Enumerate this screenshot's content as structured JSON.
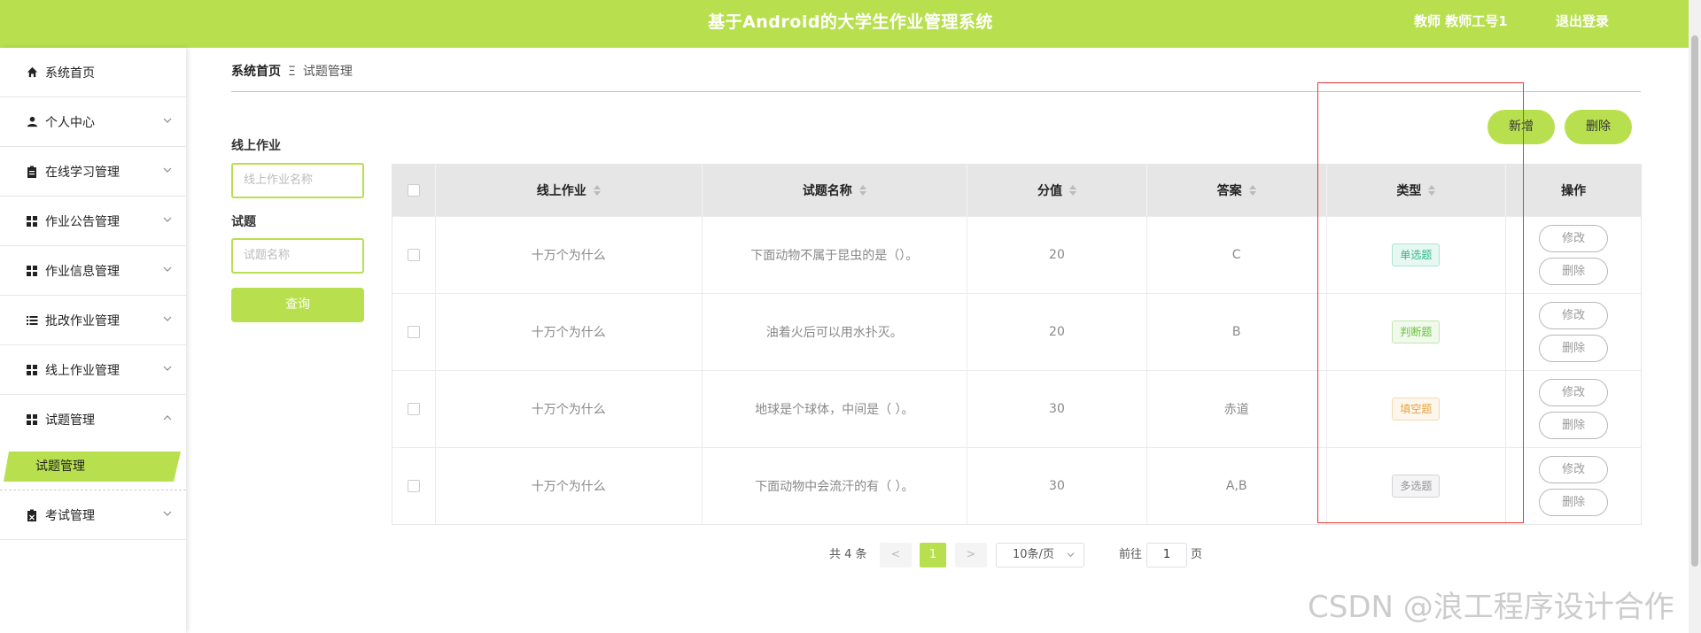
{
  "header": {
    "title": "基于Android的大学生作业管理系统",
    "user": "教师 教师工号1",
    "logout": "退出登录"
  },
  "sidebar": {
    "items": [
      {
        "label": "系统首页",
        "icon": "home-icon"
      },
      {
        "label": "个人中心",
        "icon": "user-icon"
      },
      {
        "label": "在线学习管理",
        "icon": "clipboard-icon"
      },
      {
        "label": "作业公告管理",
        "icon": "grid-icon"
      },
      {
        "label": "作业信息管理",
        "icon": "grid-icon"
      },
      {
        "label": "批改作业管理",
        "icon": "list-icon"
      },
      {
        "label": "线上作业管理",
        "icon": "grid-icon"
      },
      {
        "label": "试题管理",
        "icon": "grid-icon"
      },
      {
        "label": "考试管理",
        "icon": "clipboard-check-icon"
      }
    ],
    "submenu": {
      "label": "试题管理"
    }
  },
  "breadcrumb": {
    "home": "系统首页",
    "separator": "Ξ",
    "current": "试题管理"
  },
  "search": {
    "homework_label": "线上作业",
    "homework_placeholder": "线上作业名称",
    "question_label": "试题",
    "question_placeholder": "试题名称",
    "query_label": "查询"
  },
  "actions": {
    "add_label": "新增",
    "delete_label": "删除"
  },
  "table": {
    "columns": [
      "线上作业",
      "试题名称",
      "分值",
      "答案",
      "类型",
      "操作"
    ],
    "rows": [
      {
        "homework": "十万个为什么",
        "question": "下面动物不属于昆虫的是（）。",
        "score": "20",
        "answer": "C",
        "type": "单选题",
        "edit": "修改",
        "delete": "删除"
      },
      {
        "homework": "十万个为什么",
        "question": "油着火后可以用水扑灭。",
        "score": "20",
        "answer": "B",
        "type": "判断题",
        "edit": "修改",
        "delete": "删除"
      },
      {
        "homework": "十万个为什么",
        "question": "地球是个球体，中间是（ ）。",
        "score": "30",
        "answer": "赤道",
        "type": "填空题",
        "edit": "修改",
        "delete": "删除"
      },
      {
        "homework": "十万个为什么",
        "question": "下面动物中会流汗的有（ ）。",
        "score": "30",
        "answer": "A,B",
        "type": "多选题",
        "edit": "修改",
        "delete": "删除"
      }
    ]
  },
  "tag_colors": {
    "single": {
      "fg": "#2fb889",
      "bg": "#e7f8f2",
      "border": "#a8e6cf"
    },
    "judge": {
      "fg": "#67c23a",
      "bg": "#f0f9eb",
      "border": "#c2e7b0"
    },
    "fill": {
      "fg": "#e6a23c",
      "bg": "#fdf6ec",
      "border": "#f5dab1"
    },
    "multi": {
      "fg": "#909399",
      "bg": "#f4f4f5",
      "border": "#d3d4d6"
    }
  },
  "pagination": {
    "total": "共 4 条",
    "prev": "<",
    "current_page": "1",
    "next": ">",
    "page_size": "10条/页",
    "goto_label": "前往",
    "goto_value": "1",
    "page_unit": "页"
  },
  "watermark": "CSDN @浪工程序设计合作",
  "colors": {
    "accent": "#b8e04e",
    "highlight_box": "#e53935"
  }
}
